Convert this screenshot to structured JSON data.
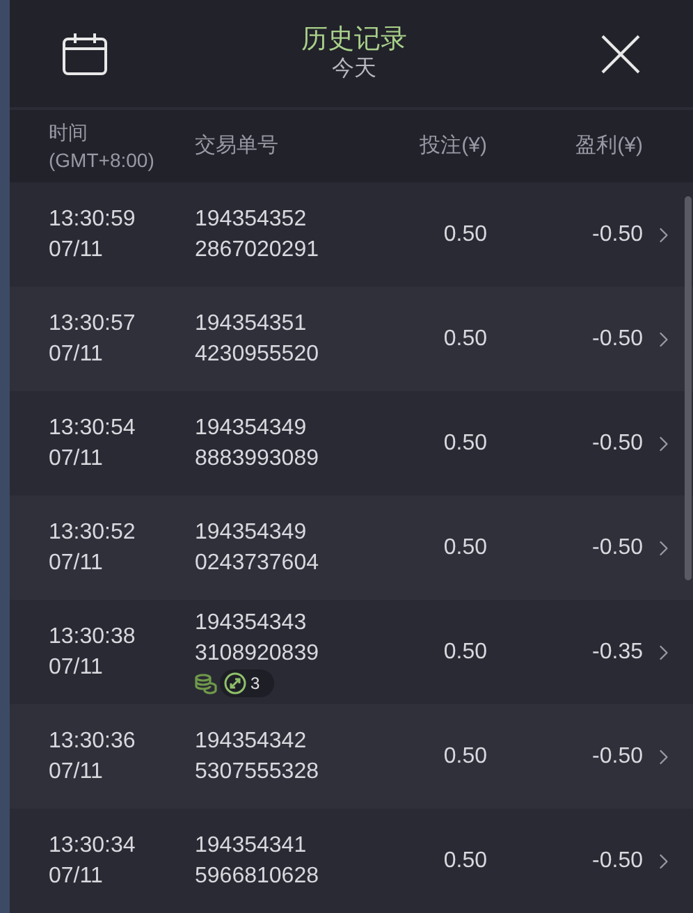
{
  "header": {
    "title": "历史记录",
    "subtitle": "今天"
  },
  "columns": [
    {
      "line1": "时间",
      "line2": "(GMT+8:00)"
    },
    {
      "line1": "交易单号"
    },
    {
      "line1": "投注(¥)"
    },
    {
      "line1": "盈利(¥)"
    }
  ],
  "rows": [
    {
      "time": "13:30:59",
      "date": "07/11",
      "order": [
        "194354352",
        "2867020291"
      ],
      "bet": "0.50",
      "profit": "-0.50"
    },
    {
      "time": "13:30:57",
      "date": "07/11",
      "order": [
        "194354351",
        "4230955520"
      ],
      "bet": "0.50",
      "profit": "-0.50"
    },
    {
      "time": "13:30:54",
      "date": "07/11",
      "order": [
        "194354349",
        "8883993089"
      ],
      "bet": "0.50",
      "profit": "-0.50"
    },
    {
      "time": "13:30:52",
      "date": "07/11",
      "order": [
        "194354349",
        "0243737604"
      ],
      "bet": "0.50",
      "profit": "-0.50"
    },
    {
      "time": "13:30:38",
      "date": "07/11",
      "order": [
        "194354343",
        "3108920839"
      ],
      "bet": "0.50",
      "profit": "-0.35",
      "badge": {
        "count": "3"
      }
    },
    {
      "time": "13:30:36",
      "date": "07/11",
      "order": [
        "194354342",
        "5307555328"
      ],
      "bet": "0.50",
      "profit": "-0.50"
    },
    {
      "time": "13:30:34",
      "date": "07/11",
      "order": [
        "194354341",
        "5966810628"
      ],
      "bet": "0.50",
      "profit": "-0.50"
    }
  ]
}
